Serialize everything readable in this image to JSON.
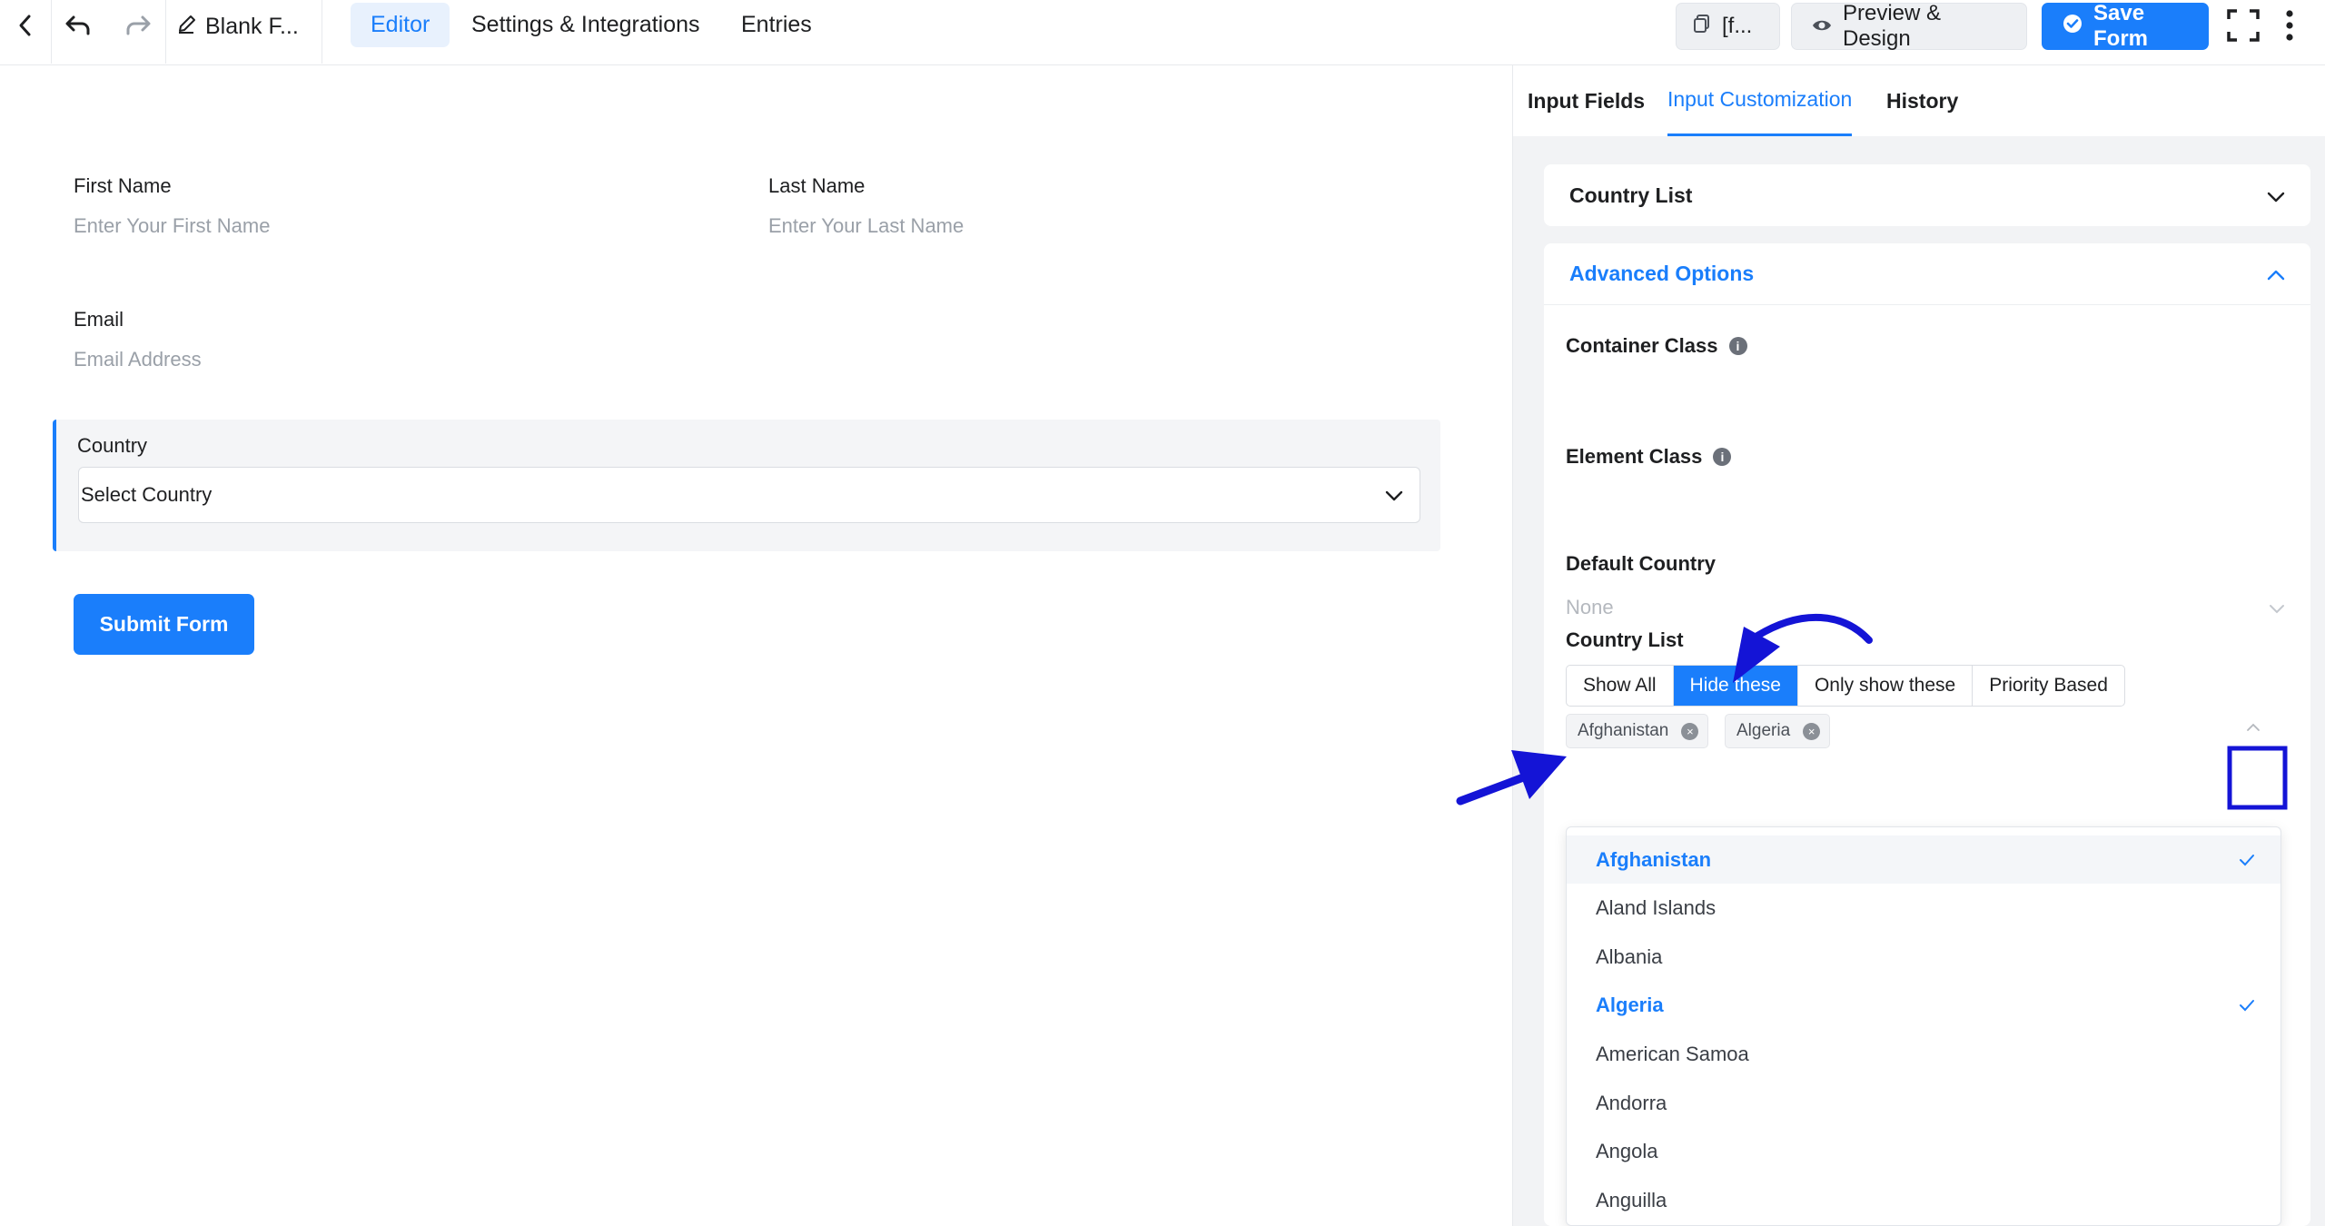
{
  "topbar": {
    "form_title": "Blank F...",
    "tabs": [
      "Editor",
      "Settings & Integrations",
      "Entries"
    ],
    "shortcode_label": "[f...",
    "preview_label": "Preview & Design",
    "save_label": "Save Form"
  },
  "form": {
    "first_name_label": "First Name",
    "first_name_placeholder": "Enter Your First Name",
    "last_name_label": "Last Name",
    "last_name_placeholder": "Enter Your Last Name",
    "email_label": "Email",
    "email_placeholder": "Email Address",
    "country_label": "Country",
    "country_value": "Select Country",
    "submit_label": "Submit Form"
  },
  "panel": {
    "tabs": [
      "Input Fields",
      "Input Customization",
      "History"
    ],
    "country_list_header": "Country List",
    "advanced_header": "Advanced Options",
    "container_class_label": "Container Class",
    "element_class_label": "Element Class",
    "default_country_label": "Default Country",
    "default_country_value": "None",
    "country_list_label": "Country List",
    "segments": [
      "Show All",
      "Hide these",
      "Only show these",
      "Priority Based"
    ],
    "tags": [
      "Afghanistan",
      "Algeria"
    ],
    "dropdown_options": [
      "Afghanistan",
      "Aland Islands",
      "Albania",
      "Algeria",
      "American Samoa",
      "Andorra",
      "Angola",
      "Anguilla"
    ]
  },
  "colors": {
    "accent": "#1a7efb",
    "annotation": "#1414d6"
  }
}
